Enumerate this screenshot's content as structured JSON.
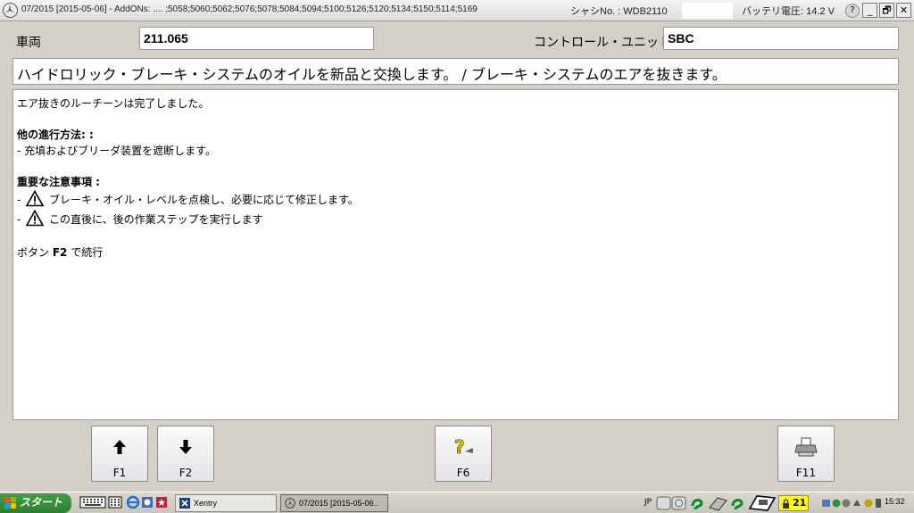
{
  "titlebar": {
    "info": "07/2015 [2015-05-06] - AddONs:  .... ;5058;5060;5062;5076;5078;5084;5094;5100;5126;5120;5134;5150;5114;5169",
    "chassis": "シャシNo. : WDB2110",
    "battery": "バッテリ電圧: 14.2 V",
    "help_label": "?",
    "btn_min": "_",
    "btn_restore": "🗗",
    "btn_close": "✕"
  },
  "header": {
    "vehicle_label": "車両",
    "vehicle_value": "211.065",
    "control_unit_label": "コントロール・ユニット",
    "control_unit_value": "SBC"
  },
  "procedure_title": "ハイドロリック・ブレーキ・システムのオイルを新品と交換します。 / ブレーキ・システムのエアを抜きます。",
  "content": {
    "status": "エア抜きのルーチーンは完了しました。",
    "other_heading": "他の進行方法: :",
    "other_item": "- 充填およびブリーダ装置を遮断します。",
    "notes_heading": "重要な注意事項 :",
    "note_prefix": "-",
    "note1": "ブレーキ・オイル・レベルを点検し、必要に応じて修正します。",
    "note2": "この直後に、後の作業ステップを実行します",
    "continue_prefix": "ボタン ",
    "continue_key": "F2",
    "continue_suffix": " で続行"
  },
  "fkeys": {
    "f1": "F1",
    "f2": "F2",
    "f6": "F6",
    "f11": "F11"
  },
  "taskbar": {
    "start": "スタート",
    "item_xentry": "Xentry",
    "item_active": "07/2015 [2015-05-06..",
    "lang": "JP",
    "badge": "21",
    "clock": "15:32"
  },
  "colors": {
    "window_bg": "#d4d0c8",
    "start_green": "#3a8f3a",
    "badge_yellow": "#ffff00"
  }
}
